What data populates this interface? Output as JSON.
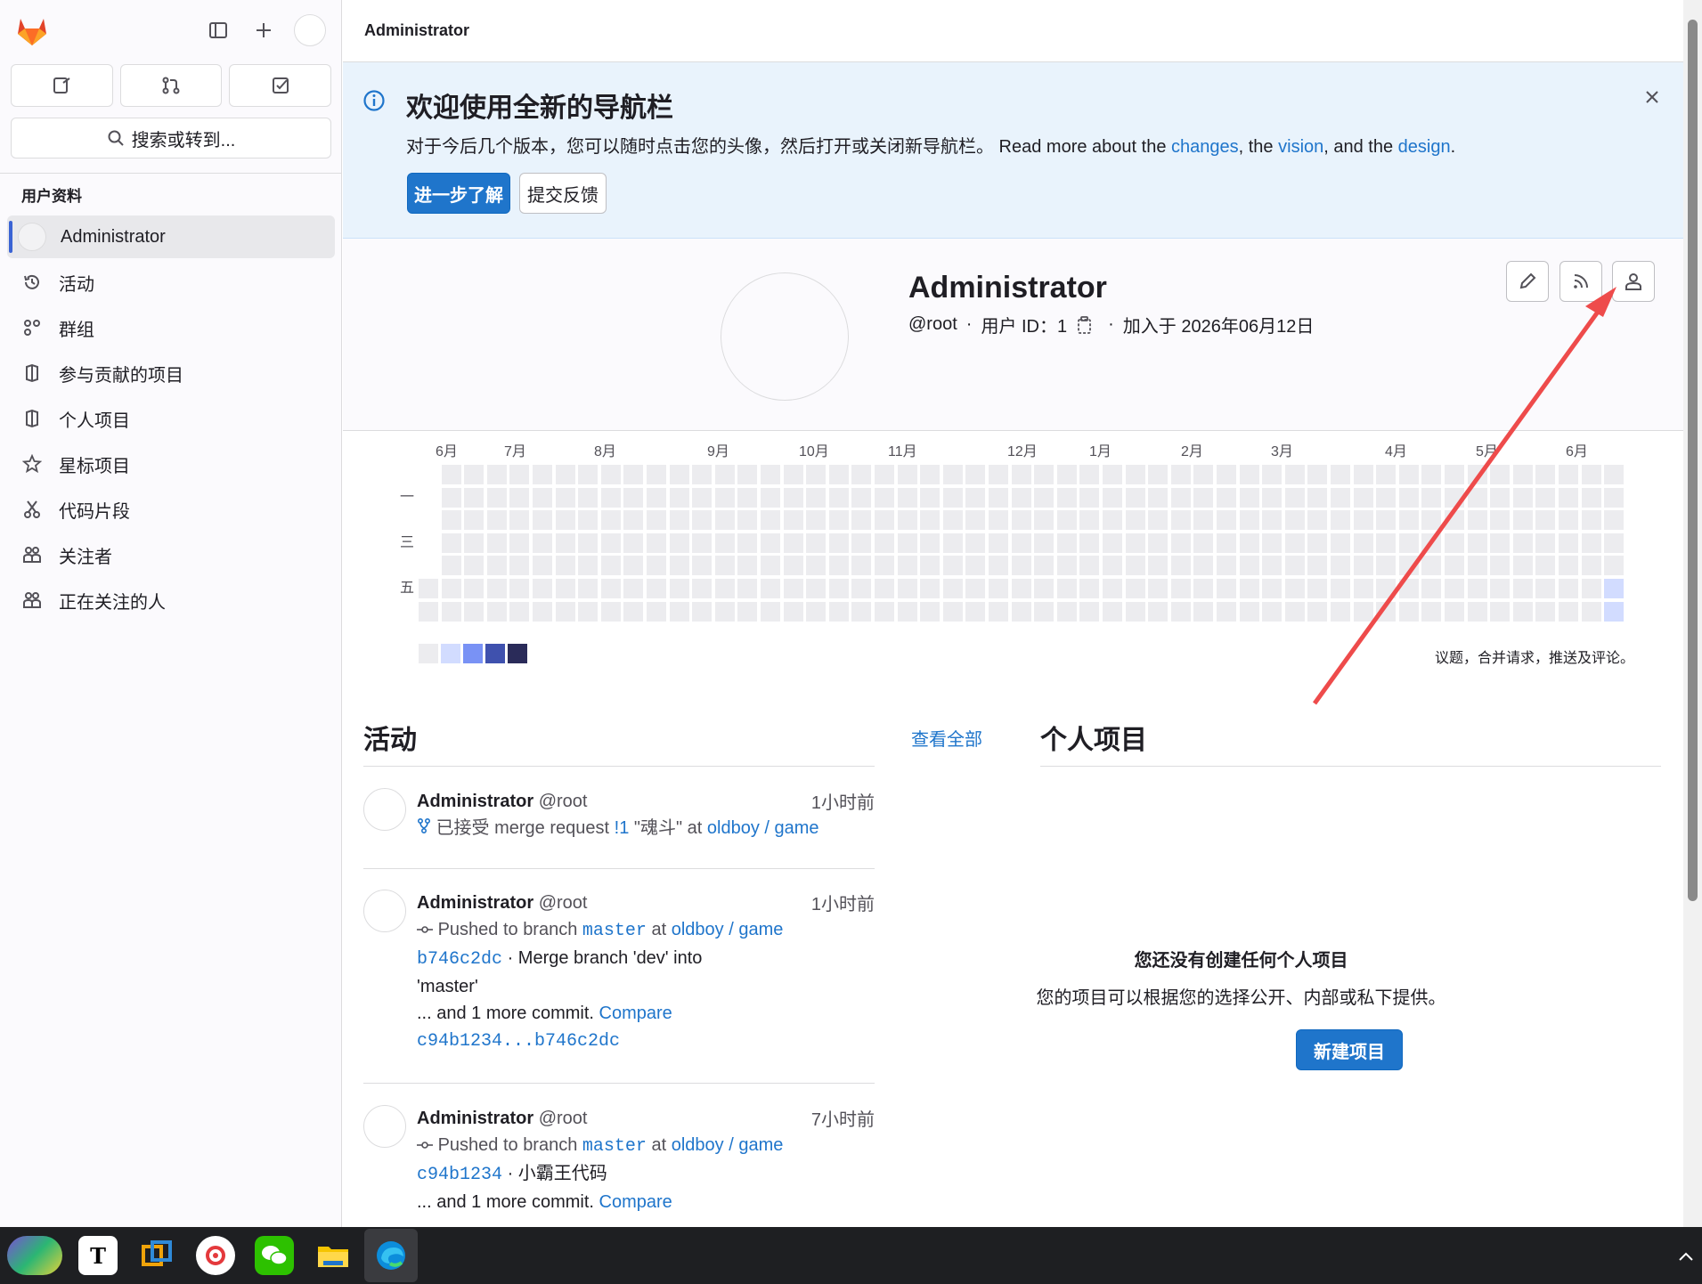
{
  "sidebar": {
    "search_label": "搜索或转到...",
    "section_label": "用户资料",
    "items": [
      {
        "label": "Administrator",
        "icon": "avatar"
      },
      {
        "label": "活动",
        "icon": "history-icon"
      },
      {
        "label": "群组",
        "icon": "group-icon"
      },
      {
        "label": "参与贡献的项目",
        "icon": "project-icon"
      },
      {
        "label": "个人项目",
        "icon": "project-icon"
      },
      {
        "label": "星标项目",
        "icon": "star-icon"
      },
      {
        "label": "代码片段",
        "icon": "snippet-icon"
      },
      {
        "label": "关注者",
        "icon": "users-icon"
      },
      {
        "label": "正在关注的人",
        "icon": "users-icon"
      }
    ]
  },
  "topbar": {
    "breadcrumb": "Administrator"
  },
  "banner": {
    "title": "欢迎使用全新的导航栏",
    "text_prefix": "对于今后几个版本，您可以随时点击您的头像，然后打开或关闭新导航栏。 Read more about the ",
    "link_changes": "changes",
    "sep1": ", the ",
    "link_vision": "vision",
    "sep2": ", and the ",
    "link_design": "design",
    "suffix": ".",
    "learn_more": "进一步了解",
    "feedback": "提交反馈"
  },
  "profile": {
    "name": "Administrator",
    "handle": "@root",
    "dot": "·",
    "user_id": "用户 ID：1",
    "joined": "加入于 2026年06月12日"
  },
  "calendar": {
    "months": [
      "6月",
      "7月",
      "8月",
      "9月",
      "10月",
      "11月",
      "12月",
      "1月",
      "2月",
      "3月",
      "4月",
      "5月",
      "6月"
    ],
    "days": [
      "一",
      "三",
      "五"
    ],
    "caption": "议题，合并请求，推送及评论。",
    "legend_colors": [
      "#ececef",
      "#d2dcff",
      "#7992f5",
      "#3f51ae",
      "#2a2b59"
    ],
    "active_cells": [
      {
        "week": 52,
        "day": 5,
        "level": 1
      },
      {
        "week": 52,
        "day": 6,
        "level": 1
      }
    ]
  },
  "activity": {
    "title": "活动",
    "view_all": "查看全部",
    "events": [
      {
        "name": "Administrator",
        "handle": "@root",
        "time": "1小时前",
        "action": "已接受 merge request ",
        "mr": "!1",
        "mr_title": " \"魂斗\" at ",
        "project": "oldboy / game"
      },
      {
        "name": "Administrator",
        "handle": "@root",
        "time": "1小时前",
        "action": "Pushed to branch ",
        "branch": "master",
        "at": " at ",
        "project": "oldboy / game",
        "commit": "b746c2dc",
        "commit_msg": " · Merge branch 'dev' into",
        "commit_msg2": "'master'",
        "more": "... and 1 more commit. ",
        "compare": "Compare",
        "range": "c94b1234...b746c2dc"
      },
      {
        "name": "Administrator",
        "handle": "@root",
        "time": "7小时前",
        "action": "Pushed to branch ",
        "branch": "master",
        "at": " at ",
        "project": "oldboy / game",
        "commit": "c94b1234",
        "commit_msg": " · 小霸王代码",
        "more": "... and 1 more commit. ",
        "compare": "Compare"
      }
    ]
  },
  "personal_projects": {
    "title": "个人项目",
    "empty_title": "您还没有创建任何个人项目",
    "empty_text": "您的项目可以根据您的选择公开、内部或私下提供。",
    "new_button": "新建项目"
  },
  "taskbar": {
    "apps": [
      "widgets",
      "typora",
      "vmware",
      "netease-music",
      "wechat",
      "file-explorer",
      "edge"
    ]
  },
  "colors": {
    "accent": "#1f75cb",
    "banner_bg": "#e9f3fc",
    "annotation_arrow": "#ee4b4b"
  }
}
